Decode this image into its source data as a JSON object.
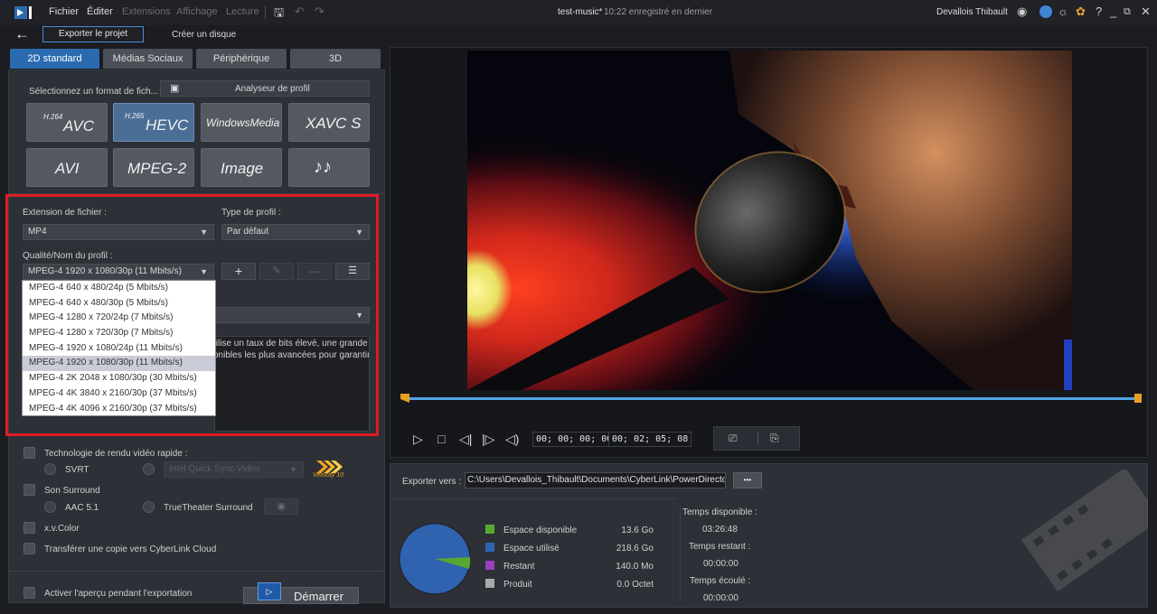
{
  "titlebar": {
    "menu": [
      "Fichier",
      "Éditer",
      "Extensions",
      "Affichage",
      "Lecture"
    ],
    "project_name": "test-music*",
    "saved_status": "10:22 enregistré en dernier",
    "user": "Devallois Thibault"
  },
  "subbar": {
    "export_project": "Exporter le projet",
    "create_disc": "Créer un disque"
  },
  "tabs": [
    "2D standard",
    "Médias Sociaux",
    "Périphérique",
    "3D"
  ],
  "format": {
    "select_label": "Sélectionnez un format de fich...",
    "profile_analyzer": "Analyseur de profil",
    "buttons": [
      {
        "sup": "H.264",
        "main": "AVC"
      },
      {
        "sup": "H.265",
        "main": "HEVC"
      },
      {
        "sup": "",
        "main": "WindowsMedia"
      },
      {
        "sup": "",
        "main": "XAVC S"
      },
      {
        "sup": "",
        "main": "AVI"
      },
      {
        "sup": "",
        "main": "MPEG-2"
      },
      {
        "sup": "",
        "main": "Image"
      },
      {
        "sup": "",
        "main": "♪♪"
      }
    ]
  },
  "settings": {
    "ext_label": "Extension de fichier :",
    "ext_value": "MP4",
    "profile_type_label": "Type de profil :",
    "profile_type_value": "Par défaut",
    "quality_label": "Qualité/Nom du profil :",
    "quality_value": "MPEG-4 1920 x 1080/30p (11 Mbits/s)",
    "description_line1": "tilise un taux de bits élevé, une grande",
    "description_line2": "onibles les plus avancées pour garantir"
  },
  "dropdown": {
    "items": [
      "MPEG-4 640 x 480/24p (5 Mbits/s)",
      "MPEG-4 640 x 480/30p (5 Mbits/s)",
      "MPEG-4 1280 x 720/24p (7 Mbits/s)",
      "MPEG-4 1280 x 720/30p (7 Mbits/s)",
      "MPEG-4 1920 x 1080/24p (11 Mbits/s)",
      "MPEG-4 1920 x 1080/30p (11 Mbits/s)",
      "MPEG-4 2K 2048 x 1080/30p (30 Mbits/s)",
      "MPEG-4 4K 3840 x 2160/30p (37 Mbits/s)",
      "MPEG-4 4K 4096 x 2160/30p (37 Mbits/s)"
    ],
    "selected_index": 5
  },
  "options": {
    "fast_render": "Technologie de rendu vidéo rapide :",
    "svrt": "SVRT",
    "intel": "Intel Quick Sync Video",
    "velocity_logo": "Velocity 10",
    "surround": "Son Surround",
    "aac": "AAC 5.1",
    "truetheater": "TrueTheater Surround",
    "xvcolor": "x.v.Color",
    "cloud": "Transférer une copie vers CyberLink Cloud",
    "preview": "Activer l'aperçu pendant l'exportation",
    "start": "Démarrer"
  },
  "player": {
    "current_time": "00; 00; 00; 00",
    "total_time": "00; 02; 05; 08"
  },
  "export": {
    "label": "Exporter vers :",
    "path": "C:\\Users\\Devallois_Thibault\\Documents\\CyberLink\\PowerDirecto",
    "browse": "•••",
    "legend": [
      {
        "label": "Espace disponible",
        "value": "13.6  Go",
        "color": "#56a832"
      },
      {
        "label": "Espace utilisé",
        "value": "218.6  Go",
        "color": "#2f63b0"
      },
      {
        "label": "Restant",
        "value": "140.0  Mo",
        "color": "#9b3fb8"
      },
      {
        "label": "Produit",
        "value": "0.0  Octet",
        "color": "#a9a9a9"
      }
    ],
    "time_available_label": "Temps disponible :",
    "time_available": "03:26:48",
    "time_remaining_label": "Temps restant :",
    "time_remaining": "00:00:00",
    "time_elapsed_label": "Temps écoulé :",
    "time_elapsed": "00:00:00"
  },
  "colors": {
    "accent": "#2a6bb0",
    "highlight_box": "#e01c24",
    "pie_used": "#2f63b0",
    "pie_free": "#56a832"
  }
}
